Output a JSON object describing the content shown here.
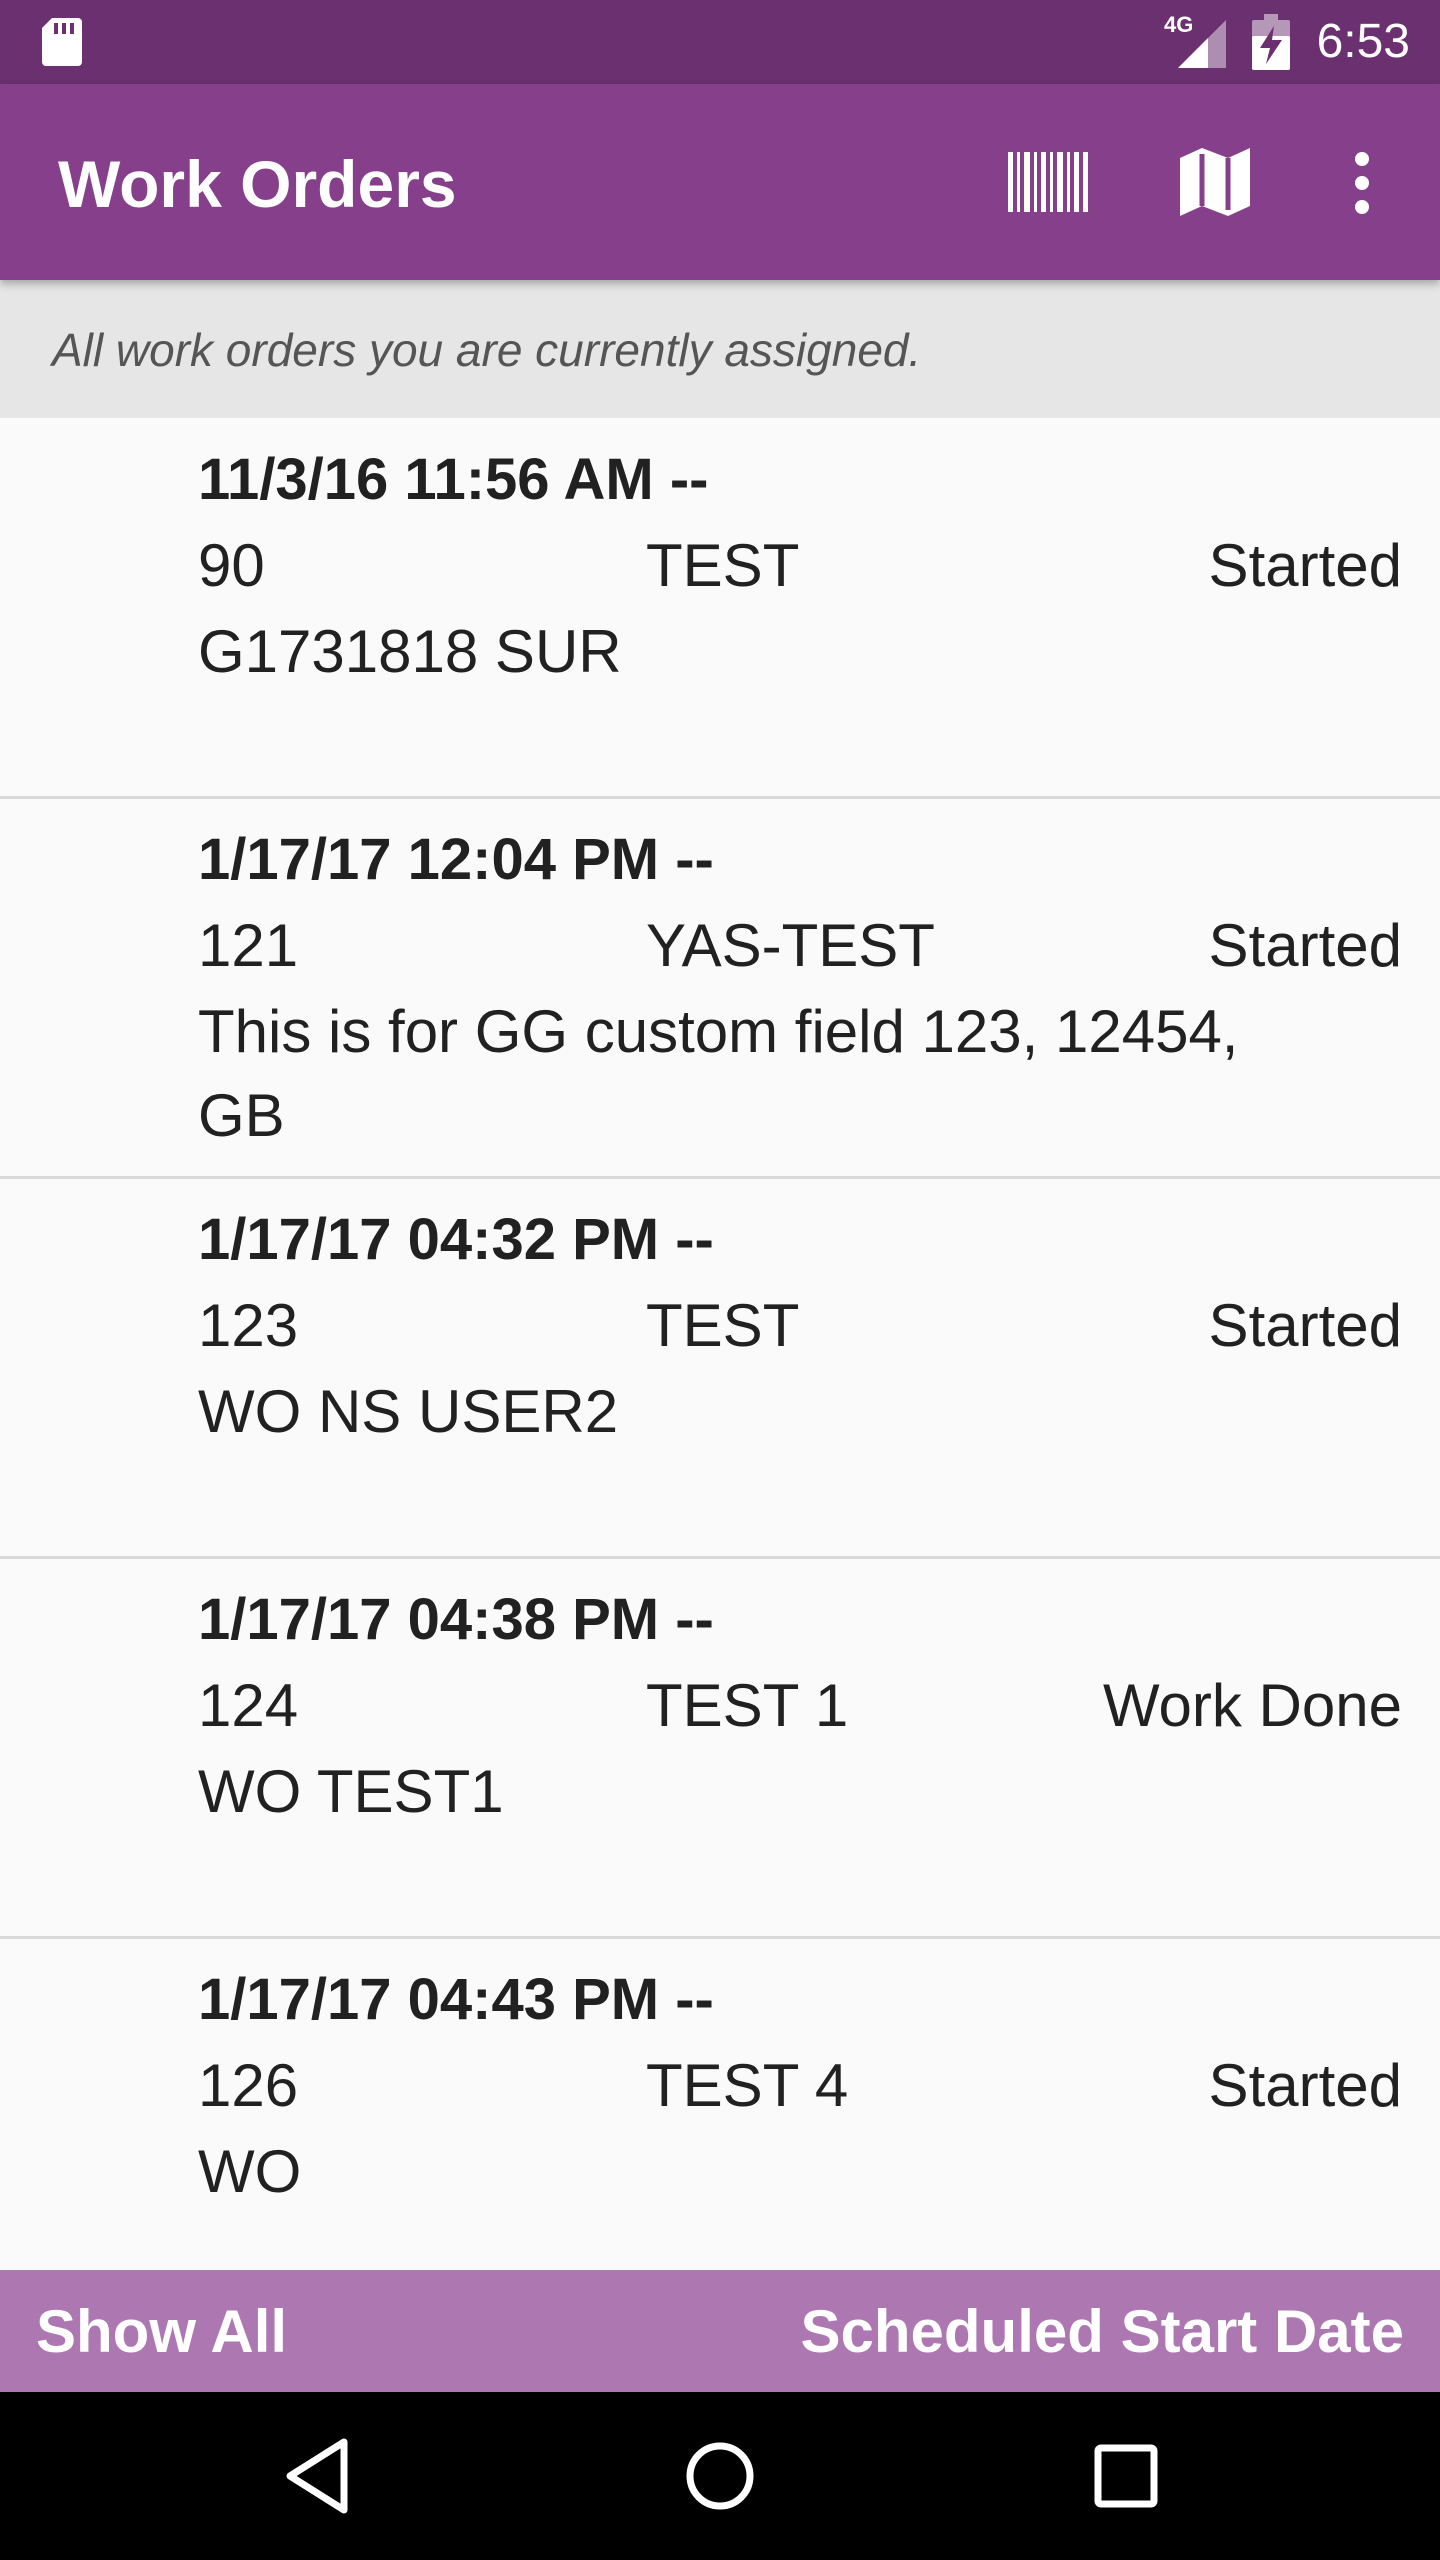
{
  "status_bar": {
    "time": "6:53",
    "network_label": "4G",
    "icons": [
      "sd-card-icon",
      "signal-4g-icon",
      "battery-charging-icon"
    ]
  },
  "app_bar": {
    "title": "Work Orders",
    "actions": [
      "barcode-scan-icon",
      "map-icon",
      "more-vert-icon"
    ],
    "color": "#86408b"
  },
  "subtitle": "All work orders you are currently assigned.",
  "work_orders": [
    {
      "date": "11/3/16 11:56 AM --",
      "number": "90",
      "name": "TEST",
      "status": "Started",
      "description": "G1731818 SUR"
    },
    {
      "date": "1/17/17 12:04 PM --",
      "number": "121",
      "name": "YAS-TEST",
      "status": "Started",
      "description": "This is for GG custom field 123, 12454, GB"
    },
    {
      "date": "1/17/17 04:32 PM --",
      "number": "123",
      "name": "TEST",
      "status": "Started",
      "description": "WO NS USER2"
    },
    {
      "date": "1/17/17 04:38 PM --",
      "number": "124",
      "name": "TEST 1",
      "status": "Work Done",
      "description": "WO TEST1"
    },
    {
      "date": "1/17/17 04:43 PM --",
      "number": "126",
      "name": "TEST 4",
      "status": "Started",
      "description": "WO"
    }
  ],
  "bottom_bar": {
    "filter_label": "Show All",
    "sort_label": "Scheduled Start Date",
    "color": "#ad77b1"
  },
  "nav_bar": {
    "icons": [
      "back-icon",
      "home-icon",
      "recents-icon"
    ]
  }
}
